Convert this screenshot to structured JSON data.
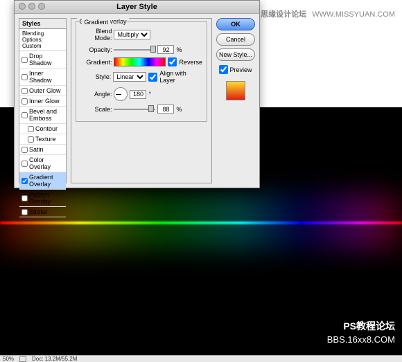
{
  "watermark": {
    "cn": "思缘设计论坛",
    "url": "WWW.MISSYUAN.COM",
    "bottom1": "PS教程论坛",
    "bottom2": "BBS.16xx8.COM"
  },
  "statusbar": {
    "zoom": "50%",
    "doc": "Doc: 13.2M/55.2M"
  },
  "dialog": {
    "title": "Layer Style",
    "styles_header": "Styles",
    "blending_options": "Blending Options: Custom",
    "items": [
      {
        "label": "Drop Shadow",
        "checked": false,
        "indent": false
      },
      {
        "label": "Inner Shadow",
        "checked": false,
        "indent": false
      },
      {
        "label": "Outer Glow",
        "checked": false,
        "indent": false
      },
      {
        "label": "Inner Glow",
        "checked": false,
        "indent": false
      },
      {
        "label": "Bevel and Emboss",
        "checked": false,
        "indent": false
      },
      {
        "label": "Contour",
        "checked": false,
        "indent": true
      },
      {
        "label": "Texture",
        "checked": false,
        "indent": true
      },
      {
        "label": "Satin",
        "checked": false,
        "indent": false
      },
      {
        "label": "Color Overlay",
        "checked": false,
        "indent": false
      },
      {
        "label": "Gradient Overlay",
        "checked": true,
        "indent": false,
        "selected": true
      },
      {
        "label": "Pattern Overlay",
        "checked": false,
        "indent": false
      },
      {
        "label": "Stroke",
        "checked": false,
        "indent": false
      }
    ],
    "settings": {
      "section_title": "Gradient Overlay",
      "group_title": "Gradient",
      "blend_mode_label": "Blend Mode:",
      "blend_mode_value": "Multiply",
      "opacity_label": "Opacity:",
      "opacity_value": "92",
      "opacity_unit": "%",
      "gradient_label": "Gradient:",
      "reverse_label": "Reverse",
      "style_label": "Style:",
      "style_value": "Linear",
      "align_label": "Align with Layer",
      "angle_label": "Angle:",
      "angle_value": "180",
      "angle_unit": "°",
      "scale_label": "Scale:",
      "scale_value": "88",
      "scale_unit": "%"
    },
    "buttons": {
      "ok": "OK",
      "cancel": "Cancel",
      "new_style": "New Style...",
      "preview": "Preview"
    }
  }
}
